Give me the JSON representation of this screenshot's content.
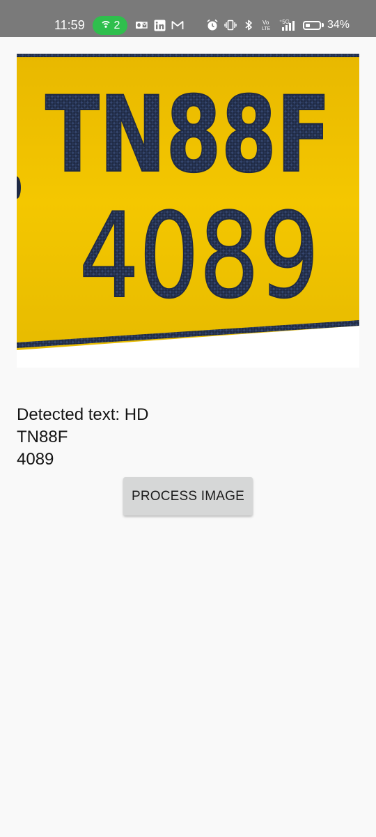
{
  "status_bar": {
    "time": "11:59",
    "hotspot_count": "2",
    "battery_percent": "34%",
    "battery_level": 0.34,
    "volte_label": "Vo LTE",
    "network_label": "5G",
    "notification_icons": [
      "outlook-icon",
      "linkedin-icon",
      "gmail-icon"
    ],
    "system_icons": [
      "alarm-icon",
      "vibrate-icon",
      "bluetooth-icon",
      "volte-icon",
      "signal-5g-icon",
      "battery-icon"
    ],
    "pill_color": "#2fbf4d",
    "background_color": "#7a7a7a"
  },
  "plate": {
    "line1": "TN88F",
    "line2": "4089",
    "plate_color": "#f2c200",
    "text_color": "#1f2a44"
  },
  "result": {
    "text": "Detected text: HD\nTN88F\n4089"
  },
  "actions": {
    "process_label": "PROCESS IMAGE"
  }
}
